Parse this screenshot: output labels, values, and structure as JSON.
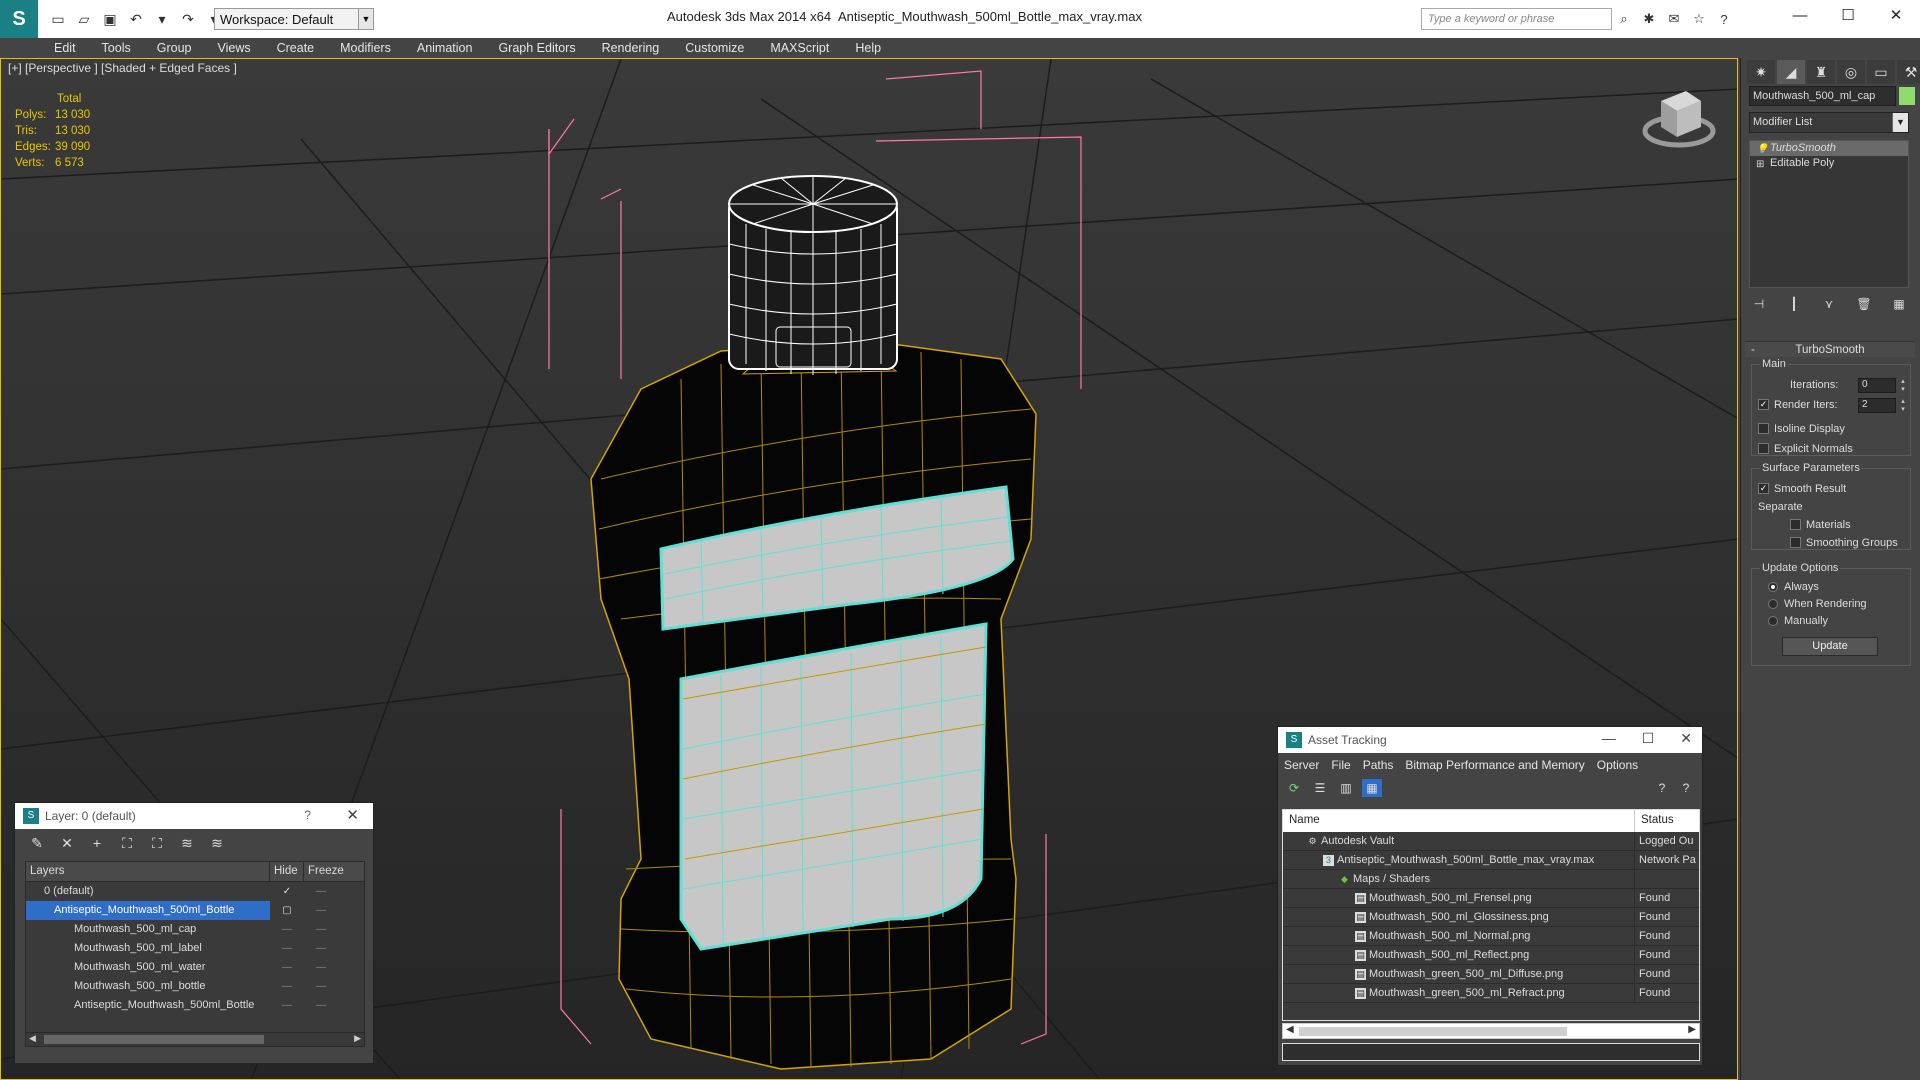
{
  "titlebar": {
    "app_title": "Autodesk 3ds Max  2014 x64",
    "file_title": "Antiseptic_Mouthwash_500ml_Bottle_max_vray.max",
    "workspace": "Workspace: Default",
    "search_placeholder": "Type a keyword or phrase"
  },
  "menu": [
    "Edit",
    "Tools",
    "Group",
    "Views",
    "Create",
    "Modifiers",
    "Animation",
    "Graph Editors",
    "Rendering",
    "Customize",
    "MAXScript",
    "Help"
  ],
  "viewport": {
    "label": "[+] [Perspective ] [Shaded + Edged Faces ]",
    "stats": {
      "total": "Total",
      "polys_label": "Polys:",
      "polys": "13 030",
      "tris_label": "Tris:",
      "tris": "13 030",
      "edges_label": "Edges:",
      "edges": "39 090",
      "verts_label": "Verts:",
      "verts": "6 573"
    }
  },
  "command_panel": {
    "object_name": "Mouthwash_500_ml_cap",
    "object_color": "#8fdc6e",
    "modifier_list": "Modifier List",
    "stack": [
      "TurboSmooth",
      "Editable Poly"
    ],
    "rollout_title": "TurboSmooth",
    "main_label": "Main",
    "iterations_label": "Iterations:",
    "iterations": "0",
    "render_iters_label": "Render Iters:",
    "render_iters": "2",
    "isoline": "Isoline Display",
    "explicit_normals": "Explicit Normals",
    "surface_params": "Surface Parameters",
    "smooth_result": "Smooth Result",
    "separate": "Separate",
    "materials": "Materials",
    "smoothing_groups": "Smoothing Groups",
    "update_options": "Update Options",
    "always": "Always",
    "when_rendering": "When Rendering",
    "manually": "Manually",
    "update": "Update"
  },
  "layer_dialog": {
    "title": "Layer: 0 (default)",
    "help": "?",
    "col_layers": "Layers",
    "col_hide": "Hide",
    "col_freeze": "Freeze",
    "rows": [
      {
        "name": "0 (default)"
      },
      {
        "name": "Antiseptic_Mouthwash_500ml_Bottle"
      },
      {
        "name": "Mouthwash_500_ml_cap"
      },
      {
        "name": "Mouthwash_500_ml_label"
      },
      {
        "name": "Mouthwash_500_ml_water"
      },
      {
        "name": "Mouthwash_500_ml_bottle"
      },
      {
        "name": "Antiseptic_Mouthwash_500ml_Bottle"
      }
    ]
  },
  "asset_dialog": {
    "title": "Asset Tracking",
    "menu": [
      "Server",
      "File",
      "Paths",
      "Bitmap Performance and Memory",
      "Options"
    ],
    "col_name": "Name",
    "col_status": "Status",
    "rows": [
      {
        "name": "Autodesk Vault",
        "status": "Logged Ou"
      },
      {
        "name": "Antiseptic_Mouthwash_500ml_Bottle_max_vray.max",
        "status": "Network Pa"
      },
      {
        "name": "Maps / Shaders",
        "status": ""
      },
      {
        "name": "Mouthwash_500_ml_Frensel.png",
        "status": "Found"
      },
      {
        "name": "Mouthwash_500_ml_Glossiness.png",
        "status": "Found"
      },
      {
        "name": "Mouthwash_500_ml_Normal.png",
        "status": "Found"
      },
      {
        "name": "Mouthwash_500_ml_Reflect.png",
        "status": "Found"
      },
      {
        "name": "Mouthwash_green_500_ml_Diffuse.png",
        "status": "Found"
      },
      {
        "name": "Mouthwash_green_500_ml_Refract.png",
        "status": "Found"
      }
    ]
  }
}
